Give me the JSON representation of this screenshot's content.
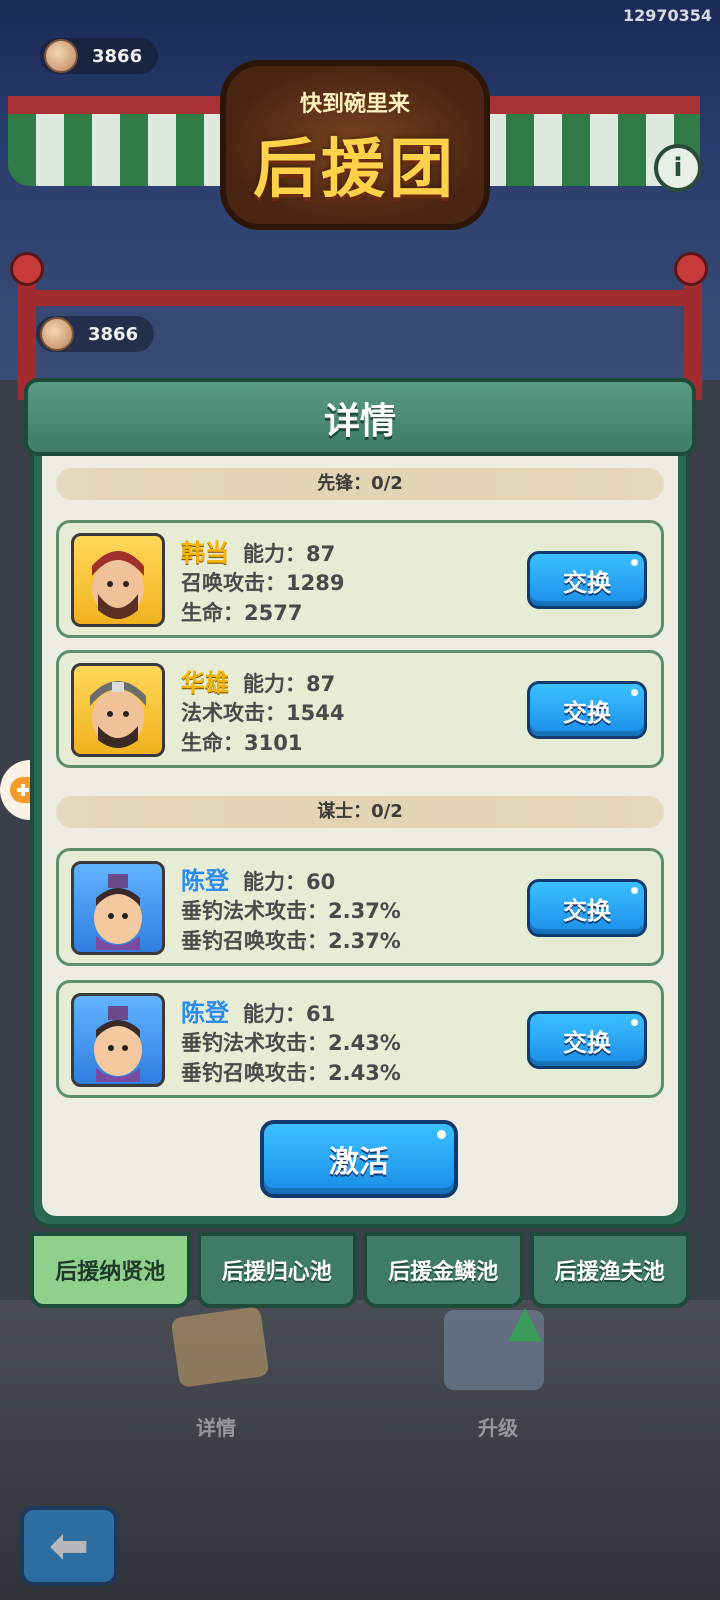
{
  "player_id": "12970354",
  "coins_top": "3866",
  "coins_mid": "3866",
  "banner": {
    "subtitle": "快到碗里来",
    "title": "后援团"
  },
  "dialog": {
    "title": "详情",
    "sections": [
      {
        "label": "先锋：0/2",
        "heroes": [
          {
            "name": "韩当",
            "ability": "能力：87",
            "stat1": "召唤攻击：1289",
            "stat2": "生命：2577",
            "button": "交换",
            "frame": "gold"
          },
          {
            "name": "华雄",
            "ability": "能力：87",
            "stat1": "法术攻击：1544",
            "stat2": "生命：3101",
            "button": "交换",
            "frame": "gold"
          }
        ]
      },
      {
        "label": "谋士：0/2",
        "heroes": [
          {
            "name": "陈登",
            "ability": "能力：60",
            "stat1": "垂钓法术攻击：2.37%",
            "stat2": "垂钓召唤攻击：2.37%",
            "button": "交换",
            "frame": "blue"
          },
          {
            "name": "陈登",
            "ability": "能力：61",
            "stat1": "垂钓法术攻击：2.43%",
            "stat2": "垂钓召唤攻击：2.43%",
            "button": "交换",
            "frame": "blue"
          }
        ]
      }
    ],
    "activate_label": "激活"
  },
  "tabs": [
    {
      "label": "后援纳贤池",
      "active": true
    },
    {
      "label": "后援归心池",
      "active": false
    },
    {
      "label": "后援金鳞池",
      "active": false
    },
    {
      "label": "后援渔夫池",
      "active": false
    }
  ],
  "bottom": {
    "details_label": "详情",
    "upgrade_label": "升级"
  },
  "icons": [
    "coin-icon",
    "info-icon",
    "gamepad-icon",
    "back-arrow-icon",
    "scroll-icon",
    "upgrade-arrow-icon"
  ]
}
